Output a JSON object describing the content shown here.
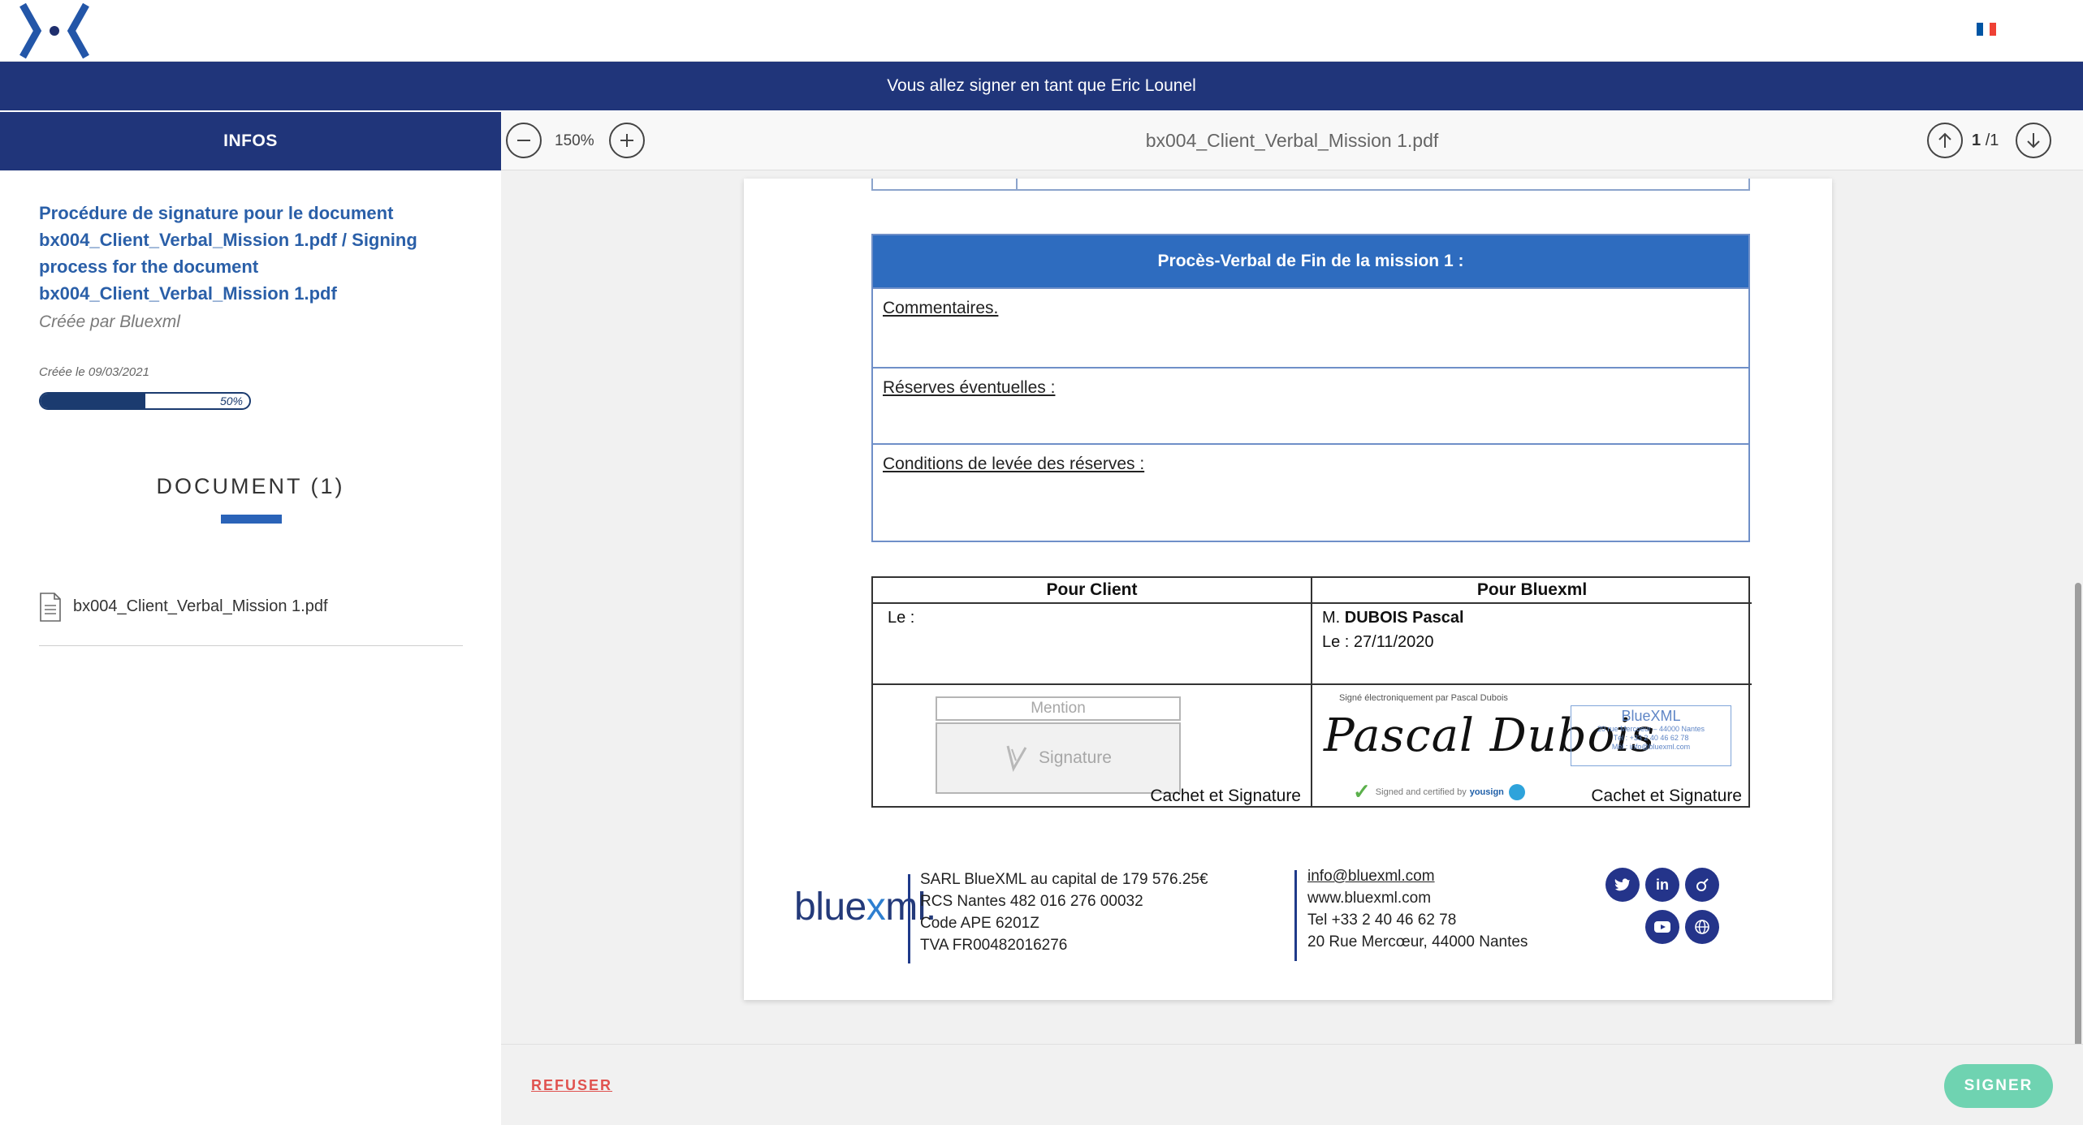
{
  "header": {
    "logo_icon": "bluexml-x-logo",
    "language_flag": "france-flag-icon",
    "flag_colors": [
      "#0055a4",
      "#ffffff",
      "#ef4135"
    ]
  },
  "banner": {
    "text": "Vous allez signer en tant que Eric Lounel"
  },
  "sidebar": {
    "tab_label": "INFOS",
    "procedure_title": "Procédure de signature pour le document bx004_Client_Verbal_Mission 1.pdf / Signing process for the document bx004_Client_Verbal_Mission 1.pdf",
    "created_by": "Créée par Bluexml",
    "created_on": "Créée le 09/03/2021",
    "progress": {
      "value": 0.5,
      "label": "50%"
    },
    "documents_heading": "DOCUMENT (1)",
    "documents": [
      {
        "name": "bx004_Client_Verbal_Mission 1.pdf",
        "icon": "file-document-icon"
      }
    ]
  },
  "viewer": {
    "zoom_level": "150%",
    "file_name": "bx004_Client_Verbal_Mission 1.pdf",
    "page_current": "1",
    "page_total": "/1"
  },
  "document": {
    "pv_title": "Procès-Verbal de Fin de la mission 1 :",
    "pv_rows": [
      "Commentaires.",
      "Réserves éventuelles :",
      "Conditions de levée des réserves :"
    ],
    "client": {
      "header": "Pour Client",
      "le": "Le :",
      "mention_placeholder": "Mention",
      "signature_placeholder": "Signature",
      "cachet": "Cachet et Signature"
    },
    "bluexml": {
      "header": "Pour Bluexml",
      "name_prefix": "M.",
      "name_bold": "DUBOIS Pascal",
      "date": "Le : 27/11/2020",
      "signed_note": "Signé électroniquement par Pascal Dubois",
      "signature": "Pascal Dubois",
      "certified": "Signed and certified by",
      "certified_brand": "yousign",
      "stamp_title": "BlueXML",
      "stamp_lines": [
        "20 rue Mercoeur – 44000 Nantes",
        "Tél : +33 2 40 46 62 78",
        "Mél : info@bluexml.com"
      ],
      "cachet": "Cachet et Signature"
    },
    "footer": {
      "logo_text_1": "blue",
      "logo_text_x": "x",
      "logo_text_2": "ml.",
      "company": [
        "SARL BlueXML au capital de 179 576.25€",
        "RCS Nantes 482 016 276 00032",
        "Code APE 6201Z",
        "TVA FR00482016276"
      ],
      "contact": [
        "info@bluexml.com",
        "www.bluexml.com",
        "Tel +33 2 40 46 62 78",
        "20 Rue Mercœur, 44000 Nantes"
      ],
      "social_icons": [
        "twitter-icon",
        "linkedin-icon",
        "viadeo-icon",
        "youtube-icon",
        "globe-icon"
      ]
    }
  },
  "actions": {
    "refuse": "REFUSER",
    "sign": "SIGNER"
  },
  "colors": {
    "navy": "#20357a",
    "link_blue": "#2a5fa8",
    "refuse_red": "#e0524f",
    "sign_green": "#6fd3b1"
  }
}
